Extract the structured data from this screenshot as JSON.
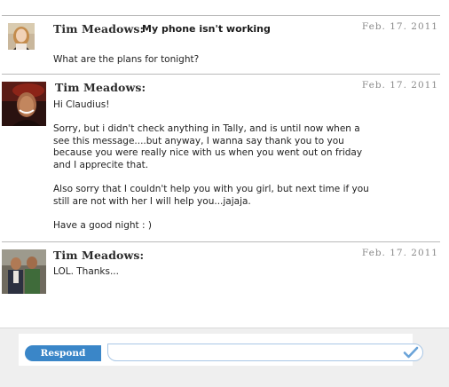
{
  "messages": [
    {
      "author": "Tim Meadows:",
      "subject": "My phone isn't working",
      "date": "Feb. 17. 2011",
      "avatar": "avatar-photo",
      "paragraphs": [
        "What are the plans for tonight?"
      ]
    },
    {
      "author": "Tim Meadows:",
      "subject": "",
      "date": "Feb. 17. 2011",
      "avatar": "avatar-photo",
      "paragraphs": [
        "Hi Claudius!",
        "Sorry, but i didn't check anything in Tally, and is until now when a see this message....but anyway, I wanna say thank you to you because you were really nice with us when you went out on friday and I apprecite that.",
        "Also sorry that I couldn't help you with you girl, but next time if you still are not with her I will help you...jajaja.",
        "Have a good night : )"
      ]
    },
    {
      "author": "Tim Meadows:",
      "subject": "",
      "date": "Feb. 17. 2011",
      "avatar": "avatar-photo",
      "paragraphs": [
        "LOL. Thanks..."
      ]
    }
  ],
  "respond": {
    "button_label": "Respond",
    "input_value": "",
    "submit_icon": "checkmark-icon"
  },
  "colors": {
    "respond_button": "#3a86c8",
    "input_border": "#a9c7e6",
    "separator": "#b9b9b9",
    "date_text": "#8a8a8a"
  }
}
